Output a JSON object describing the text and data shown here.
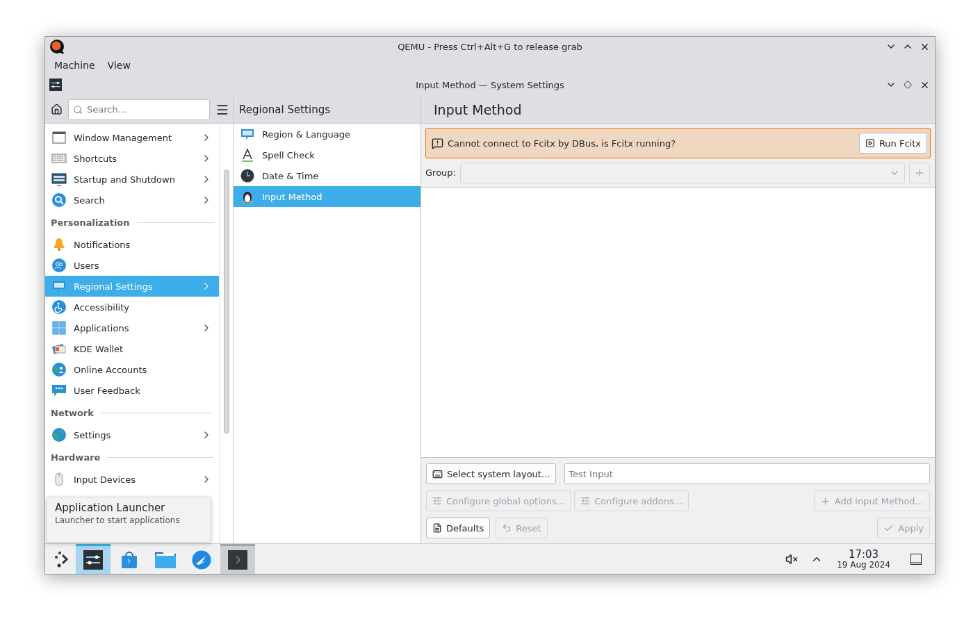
{
  "qemu_window": {
    "title": "QEMU - Press Ctrl+Alt+G to release grab",
    "menu": [
      "Machine",
      "View"
    ]
  },
  "settings_window": {
    "title": "Input Method — System Settings"
  },
  "sidebar": {
    "search": {
      "placeholder": "Search..."
    },
    "sections": [
      {
        "items": [
          {
            "label": "Window Management",
            "has_children": true,
            "selected": false
          },
          {
            "label": "Shortcuts",
            "has_children": true,
            "selected": false
          },
          {
            "label": "Startup and Shutdown",
            "has_children": true,
            "selected": false
          },
          {
            "label": "Search",
            "has_children": true,
            "selected": false
          }
        ]
      },
      {
        "heading": "Personalization",
        "items": [
          {
            "label": "Notifications",
            "has_children": false,
            "selected": false
          },
          {
            "label": "Users",
            "has_children": false,
            "selected": false
          },
          {
            "label": "Regional Settings",
            "has_children": true,
            "selected": true
          },
          {
            "label": "Accessibility",
            "has_children": false,
            "selected": false
          },
          {
            "label": "Applications",
            "has_children": true,
            "selected": false
          },
          {
            "label": "KDE Wallet",
            "has_children": false,
            "selected": false
          },
          {
            "label": "Online Accounts",
            "has_children": false,
            "selected": false
          },
          {
            "label": "User Feedback",
            "has_children": false,
            "selected": false
          }
        ]
      },
      {
        "heading": "Network",
        "items": [
          {
            "label": "Settings",
            "has_children": true,
            "selected": false
          }
        ]
      },
      {
        "heading": "Hardware",
        "items": [
          {
            "label": "Input Devices",
            "has_children": true,
            "selected": false
          }
        ]
      }
    ]
  },
  "category": {
    "title": "Regional Settings",
    "items": [
      {
        "label": "Region & Language",
        "selected": false
      },
      {
        "label": "Spell Check",
        "selected": false
      },
      {
        "label": "Date & Time",
        "selected": false
      },
      {
        "label": "Input Method",
        "selected": true
      }
    ]
  },
  "page": {
    "title": "Input Method",
    "message": {
      "text": "Cannot connect to Fcitx by DBus, is Fcitx running?",
      "action": "Run Fcitx"
    },
    "group": {
      "label": "Group:"
    },
    "select_layout": {
      "label": "Select system layout...",
      "disabled": false
    },
    "test_input": {
      "placeholder": "Test Input"
    },
    "configure_global": {
      "label": "Configure global options...",
      "disabled": true
    },
    "configure_addons": {
      "label": "Configure addons...",
      "disabled": true
    },
    "add_input_method": {
      "label": "Add Input Method...",
      "disabled": true
    },
    "defaults": {
      "label": "Defaults",
      "disabled": false
    },
    "reset": {
      "label": "Reset",
      "disabled": true
    },
    "apply": {
      "label": "Apply",
      "disabled": true
    }
  },
  "tooltip": {
    "title": "Application Launcher",
    "subtitle": "Launcher to start applications"
  },
  "taskbar": {
    "apps": [
      {
        "selected": true,
        "open": true
      },
      {
        "selected": false,
        "open": false
      },
      {
        "selected": false,
        "open": false
      },
      {
        "selected": false,
        "open": false
      },
      {
        "selected": false,
        "open": true
      }
    ],
    "clock": {
      "time": "17:03",
      "date": "19 Aug 2024"
    }
  }
}
